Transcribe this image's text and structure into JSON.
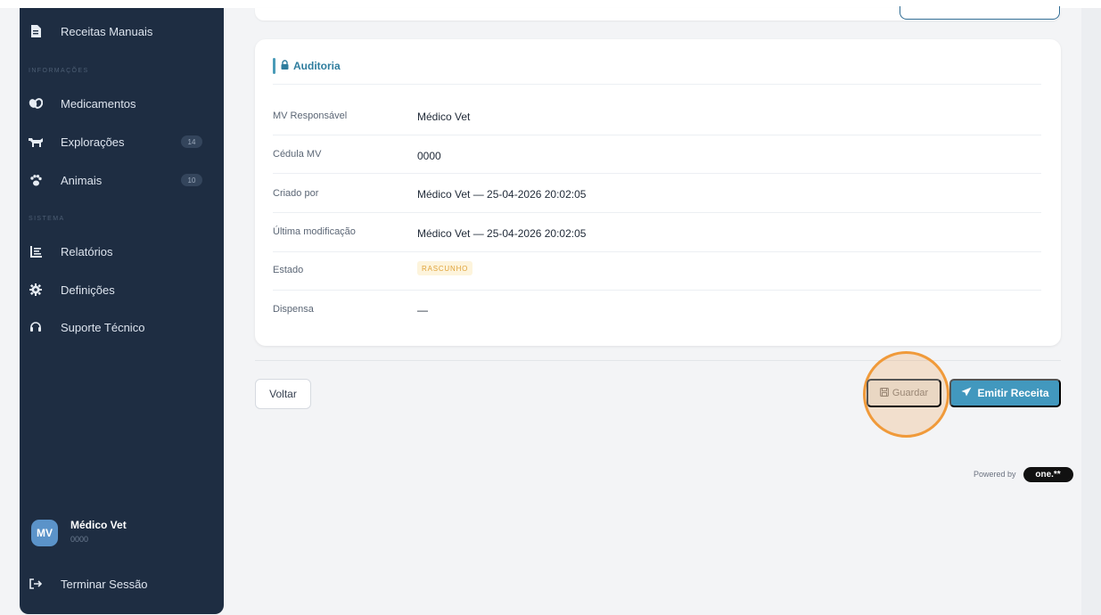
{
  "sidebar": {
    "items_top": [
      {
        "label": "Receitas Manuais",
        "icon": "document-icon"
      }
    ],
    "section_info": "INFORMAÇÕES",
    "items_info": [
      {
        "label": "Medicamentos",
        "icon": "pills-icon"
      },
      {
        "label": "Explorações",
        "icon": "cow-icon",
        "badge": "14"
      },
      {
        "label": "Animais",
        "icon": "paw-icon",
        "badge": "10"
      }
    ],
    "section_system": "SISTEMA",
    "items_system": [
      {
        "label": "Relatórios",
        "icon": "report-icon"
      },
      {
        "label": "Definições",
        "icon": "gear-icon"
      },
      {
        "label": "Suporte Técnico",
        "icon": "headset-icon"
      }
    ],
    "user": {
      "initials": "MV",
      "name": "Médico Vet",
      "id": "0000"
    },
    "logout_label": "Terminar Sessão"
  },
  "audit": {
    "title": "Auditoria",
    "rows": [
      {
        "label": "MV Responsável",
        "value": "Médico Vet"
      },
      {
        "label": "Cédula MV",
        "value": "0000"
      },
      {
        "label": "Criado por",
        "value": "Médico Vet — 25-04-2026 20:02:05"
      },
      {
        "label": "Última modificação",
        "value": "Médico Vet — 25-04-2026 20:02:05"
      },
      {
        "label": "Estado",
        "badge": "RASCUNHO",
        "badge_color": "#e0a33a"
      },
      {
        "label": "Dispensa",
        "value": "—"
      }
    ]
  },
  "actions": {
    "back_label": "Voltar",
    "save_label": "Guardar",
    "emit_label": "Emitir Receita"
  },
  "footer": {
    "powered_by": "Powered by",
    "brand": "one.**"
  },
  "colors": {
    "sidebar_bg": "#1e2d42",
    "accent": "#4298be",
    "highlight": "#f09a3a"
  }
}
